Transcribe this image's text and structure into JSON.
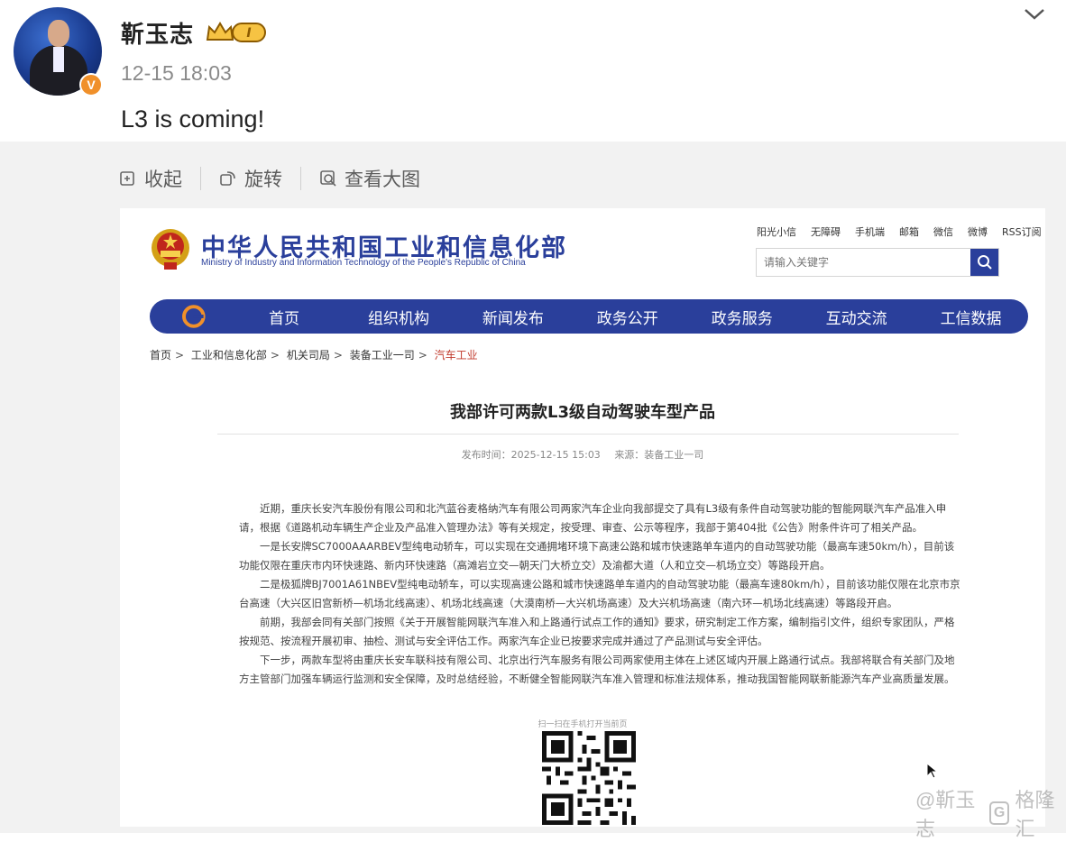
{
  "post": {
    "username": "靳玉志",
    "badge_level": "I",
    "timestamp": "12-15 18:03",
    "text": "L3 is coming!",
    "verified": "V"
  },
  "toolbar": {
    "collapse_label": "收起",
    "rotate_label": "旋转",
    "view_large_label": "查看大图"
  },
  "doc": {
    "ministry_cn": "中华人民共和国工业和信息化部",
    "ministry_en": "Ministry of Industry and Information Technology of the People's Republic of China",
    "top_links": [
      "阳光小信",
      "无障碍",
      "手机端",
      "邮箱",
      "微信",
      "微博",
      "RSS订阅"
    ],
    "search_placeholder": "请输入关键字",
    "nav": [
      "首页",
      "组织机构",
      "新闻发布",
      "政务公开",
      "政务服务",
      "互动交流",
      "工信数据"
    ],
    "breadcrumb": [
      "首页",
      "工业和信息化部",
      "机关司局",
      "装备工业一司",
      "汽车工业"
    ],
    "title": "我部许可两款L3级自动驾驶车型产品",
    "publish_time": "发布时间：2025-12-15 15:03",
    "source": "来源：装备工业一司",
    "paragraphs": [
      "近期，重庆长安汽车股份有限公司和北汽蓝谷麦格纳汽车有限公司两家汽车企业向我部提交了具有L3级有条件自动驾驶功能的智能网联汽车产品准入申请，根据《道路机动车辆生产企业及产品准入管理办法》等有关规定，按受理、审查、公示等程序，我部于第404批《公告》附条件许可了相关产品。",
      "一是长安牌SC7000AAARBEV型纯电动轿车，可以实现在交通拥堵环境下高速公路和城市快速路单车道内的自动驾驶功能（最高车速50km/h），目前该功能仅限在重庆市内环快速路、新内环快速路（高滩岩立交—朝天门大桥立交）及渝都大道（人和立交—机场立交）等路段开启。",
      "二是极狐牌BJ7001A61NBEV型纯电动轿车，可以实现高速公路和城市快速路单车道内的自动驾驶功能（最高车速80km/h），目前该功能仅限在北京市京台高速（大兴区旧宫新桥—机场北线高速）、机场北线高速（大漠南桥—大兴机场高速）及大兴机场高速（南六环—机场北线高速）等路段开启。",
      "前期，我部会同有关部门按照《关于开展智能网联汽车准入和上路通行试点工作的通知》要求，研究制定工作方案，编制指引文件，组织专家团队，严格按规范、按流程开展初审、抽检、测试与安全评估工作。两家汽车企业已按要求完成并通过了产品测试与安全评估。",
      "下一步，两款车型将由重庆长安车联科技有限公司、北京出行汽车服务有限公司两家使用主体在上述区域内开展上路通行试点。我部将联合有关部门及地方主管部门加强车辆运行监测和安全保障，及时总结经验，不断健全智能网联汽车准入管理和标准法规体系，推动我国智能网联新能源汽车产业高质量发展。"
    ],
    "qr_caption": "扫一扫在手机打开当前页"
  },
  "watermark": {
    "text": "@靳玉志",
    "brand": "格隆汇"
  },
  "colors": {
    "ministry_blue": "#2a3f9b",
    "verified_orange": "#f0902a"
  }
}
